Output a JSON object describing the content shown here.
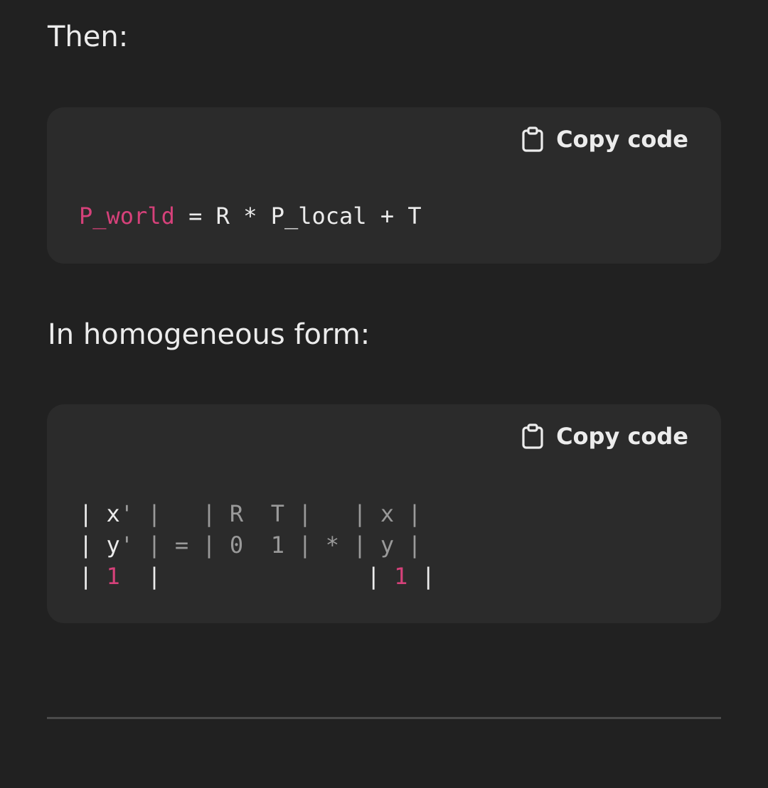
{
  "paragraphs": {
    "then": "Then:",
    "homogeneous": "In homogeneous form:"
  },
  "code_blocks": [
    {
      "copy_label": "Copy code",
      "copy_icon": "clipboard-icon",
      "tokens": {
        "var": "P_world",
        "rest": " = R * P_local + T"
      }
    },
    {
      "copy_label": "Copy code",
      "copy_icon": "clipboard-icon",
      "lines": {
        "l1_a": "| x",
        "l1_b": "' |   | R  T |   | x |",
        "l2_a": "| y",
        "l2_b": "' | = | 0  1 | * | y |",
        "l3_a": "| ",
        "l3_num1": "1",
        "l3_b": "  |               | ",
        "l3_num2": "1",
        "l3_c": " |"
      }
    }
  ],
  "colors": {
    "background": "#212121",
    "code_background": "#2b2b2b",
    "accent": "#d6417a",
    "text": "#ececec",
    "muted": "#9a9a9a"
  }
}
